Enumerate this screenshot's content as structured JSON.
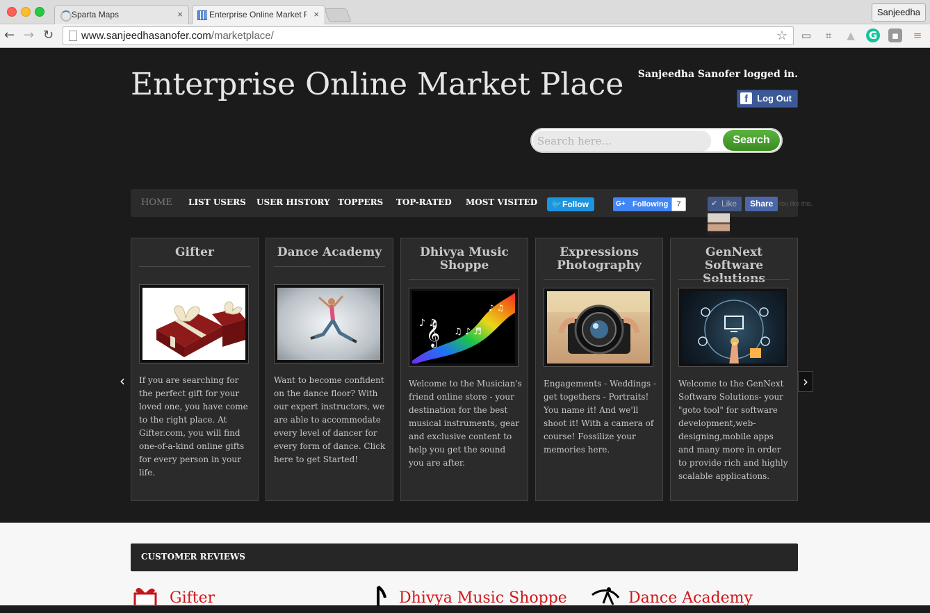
{
  "browser": {
    "tabs": [
      {
        "title": "Sparta Maps",
        "close": "×"
      },
      {
        "title": "Enterprise Online Market Pl",
        "close": "×"
      }
    ],
    "profile": "Sanjeedha",
    "url_host": "www.sanjeedhasanofer.com",
    "url_path": "/marketplace/",
    "back": "←",
    "forward": "→",
    "reload": "↻",
    "star": "☆"
  },
  "header": {
    "title": "Enterprise Online Market Place",
    "logged_in": "Sanjeedha Sanofer logged in.",
    "logout_label": "Log Out",
    "logout_icon": "f"
  },
  "search": {
    "placeholder": "Search here...",
    "button": "Search"
  },
  "nav": {
    "items": [
      "HOME",
      "LIST USERS",
      "USER HISTORY",
      "TOPPERS",
      "TOP-RATED",
      "MOST VISITED"
    ],
    "twitter_follow": "Follow",
    "twitter_icon": "🐦",
    "gplus_icon": "G+",
    "gplus_following": "Following",
    "gplus_count": "7",
    "fb_like": "Like",
    "fb_like_icon": "✔",
    "fb_share": "Share",
    "fb_hint": "You like this."
  },
  "slider": {
    "prev": "‹",
    "next": "›",
    "cards": [
      {
        "title": "Gifter",
        "description": "If you are searching for the perfect gift for your loved one, you have come to the right place. At Gifter.com, you will find one-of-a-kind online gifts for every person in your life."
      },
      {
        "title": "Dance Academy",
        "description": "Want to become confident on the dance floor? With our expert instructors, we are able to accommodate every level of dancer for every form of dance. Click here to get Started!"
      },
      {
        "title": "Dhivya Music Shoppe",
        "description": "Welcome to the Musician's friend online store - your destination for the best musical instruments, gear and exclusive content to help you get the sound you are after."
      },
      {
        "title": "Expressions Photography",
        "description": "Engagements - Weddings - get togethers - Portraits! You name it! And we'll shoot it! With a camera of course! Fossilize your memories here."
      },
      {
        "title": "GenNext Software Solutions",
        "description": "Welcome to the GenNext Software Solutions- your \"goto tool\" for software development,web-designing,mobile apps and many more in order to provide rich and highly scalable applications."
      }
    ]
  },
  "reviews": {
    "heading": "CUSTOMER REVIEWS",
    "items": [
      "Gifter",
      "Dhivya Music Shoppe",
      "Dance Academy"
    ]
  },
  "colors": {
    "accent_green": "#3a8b22",
    "review_link": "#d2171a",
    "facebook": "#3b5998",
    "twitter": "#1b95e0"
  }
}
